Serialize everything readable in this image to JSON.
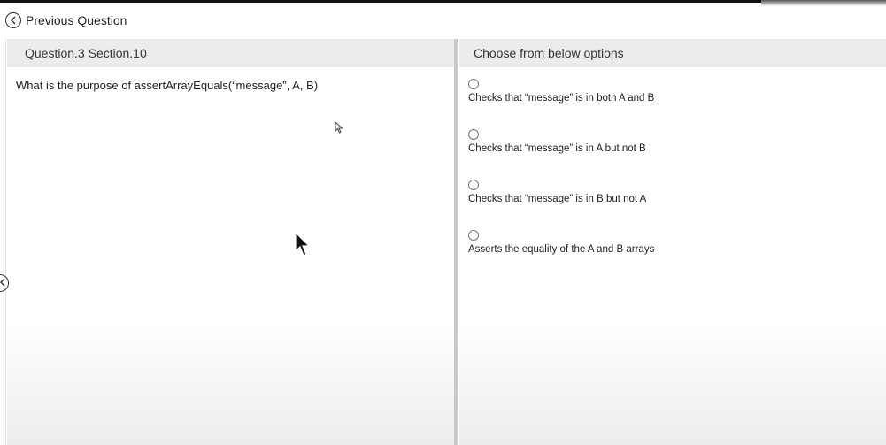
{
  "nav": {
    "previous_label": "Previous Question"
  },
  "question_panel": {
    "header": "Question.3 Section.10",
    "text": "What is the purpose of assertArrayEquals(“message”, A, B)"
  },
  "options_panel": {
    "header": "Choose from below options",
    "options": [
      {
        "label": "Checks that “message” is in both A and B",
        "selected": false
      },
      {
        "label": "Checks that “message” is in A but not B",
        "selected": false
      },
      {
        "label": "Checks that “message” is in B but not A",
        "selected": false
      },
      {
        "label": "Asserts the equality of the A and B arrays",
        "selected": false
      }
    ]
  },
  "icons": {
    "previous": "chevron-left-icon",
    "side_toggle": "chevron-left-icon",
    "cursors": [
      "mouse-pointer-icon",
      "mouse-pointer-icon"
    ]
  },
  "colors": {
    "header_bg": "#ececec",
    "divider": "#c9c9c9",
    "text": "#222222"
  }
}
